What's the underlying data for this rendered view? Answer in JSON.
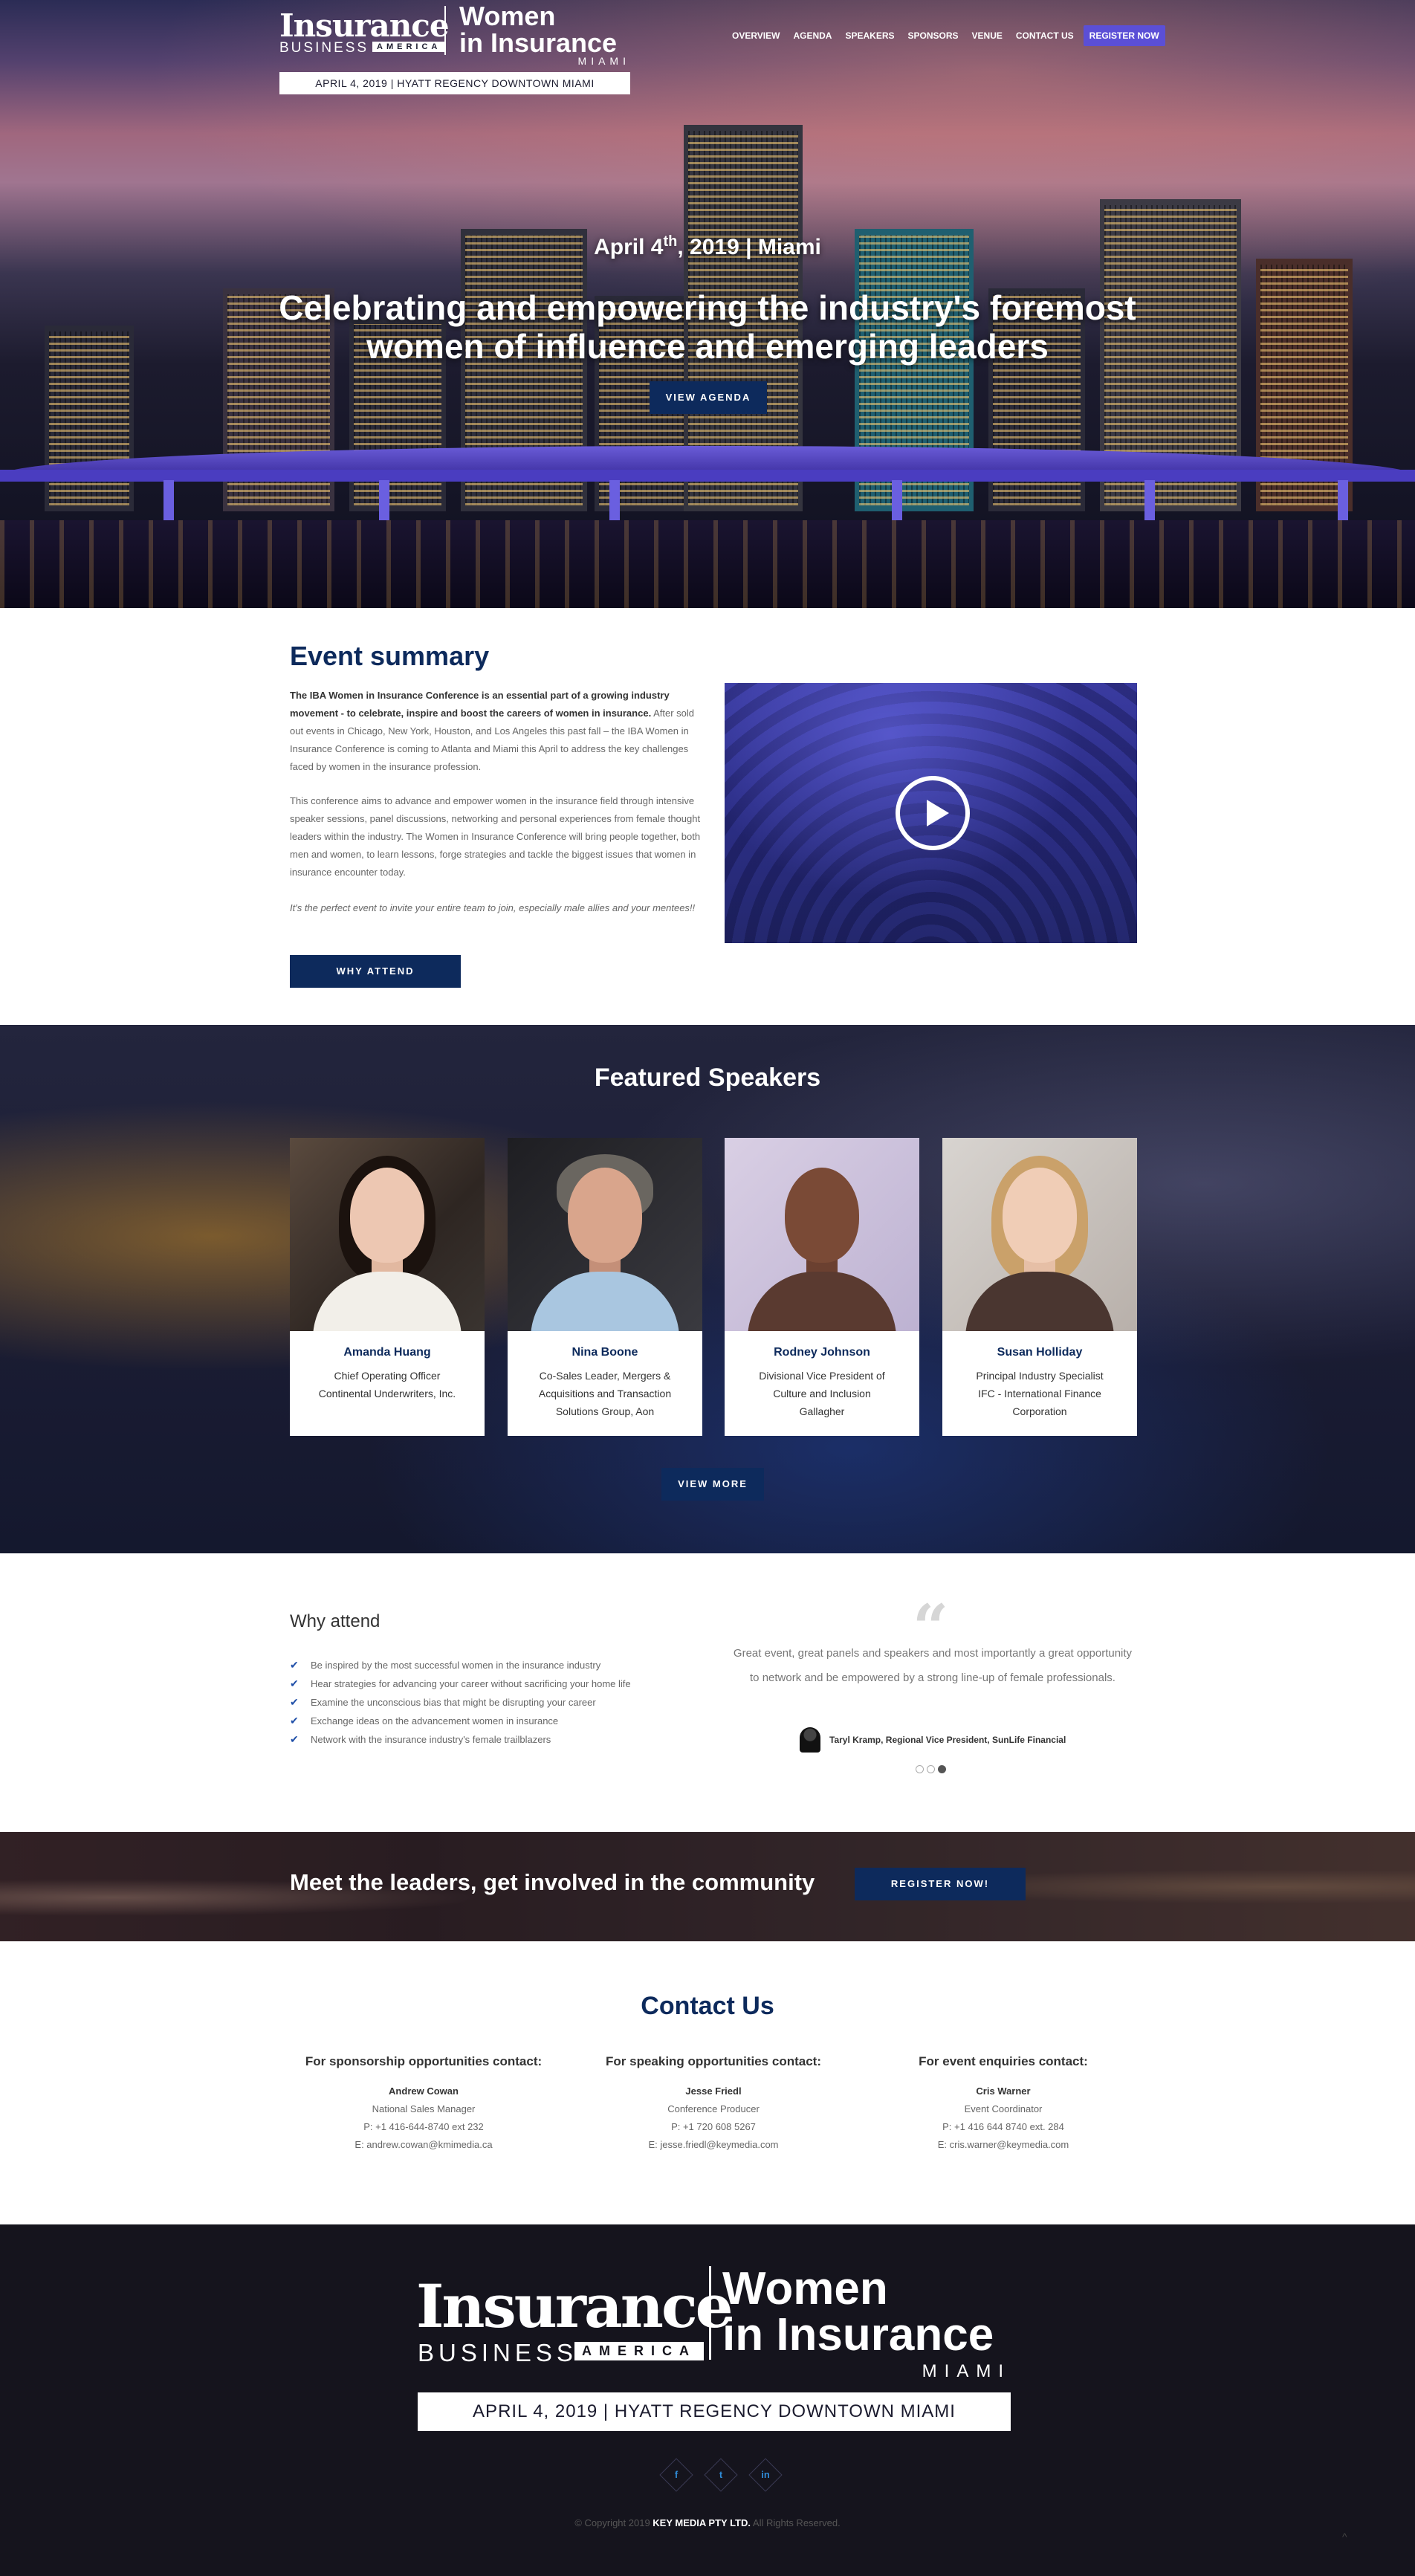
{
  "header": {
    "logo": {
      "insurance": "Insurance",
      "business": "BUSINESS",
      "america": "AMERICA",
      "women": "Women",
      "in_insurance": "in Insurance",
      "city": "MIAMI"
    },
    "date_venue": "APRIL 4, 2019  |  HYATT REGENCY DOWNTOWN MIAMI",
    "nav": [
      "OVERVIEW",
      "AGENDA",
      "SPEAKERS",
      "SPONSORS",
      "VENUE",
      "CONTACT US"
    ],
    "register_label": "REGISTER NOW",
    "register_color": "#5b4fd6"
  },
  "hero": {
    "date_prefix": "April 4",
    "date_sup": "th",
    "date_suffix": ", 2019 | Miami",
    "headline_1": "Celebrating and empowering the industry's foremost",
    "headline_2": "women of influence and emerging leaders",
    "button": "VIEW AGENDA"
  },
  "summary": {
    "title": "Event summary",
    "p1_bold": "The IBA Women in Insurance Conference is an essential part of a growing industry movement - to celebrate, inspire and boost the careers of women in insurance.",
    "p1_rest": " After sold out events in Chicago, New York, Houston, and Los Angeles this past fall – the IBA Women in Insurance Conference is coming to Atlanta and Miami this April to address the key challenges faced by women in the insurance profession.",
    "p2": "This conference aims to advance and empower women in the insurance field through intensive speaker sessions, panel discussions, networking and personal experiences from female thought leaders within the industry. The Women in Insurance Conference will bring people together, both men and women, to learn lessons, forge strategies and tackle the biggest issues that women in insurance encounter today.",
    "p3": "It's the perfect event to invite your entire team to join, especially male allies and your mentees!!",
    "button": "WHY ATTEND",
    "video_icon": "play-icon",
    "brand_color": "#0d2a5c"
  },
  "speakers": {
    "title": "Featured Speakers",
    "items": [
      {
        "name": "Amanda Huang",
        "role_1": "Chief Operating Officer",
        "role_2": "Continental Underwriters, Inc.",
        "role_3": ""
      },
      {
        "name": "Nina Boone",
        "role_1": "Co-Sales Leader, Mergers &",
        "role_2": "Acquisitions and Transaction",
        "role_3": "Solutions Group, Aon"
      },
      {
        "name": "Rodney Johnson",
        "role_1": "Divisional Vice President of",
        "role_2": "Culture and Inclusion",
        "role_3": "Gallagher"
      },
      {
        "name": "Susan Holliday",
        "role_1": "Principal Industry Specialist",
        "role_2": "IFC - International Finance",
        "role_3": "Corporation"
      }
    ],
    "button": "VIEW MORE"
  },
  "why": {
    "title": "Why attend",
    "items": [
      "Be inspired by the most successful women in the insurance industry",
      "Hear strategies for advancing your career without sacrificing your home life",
      "Examine the unconscious bias that might be disrupting your career",
      "Exchange ideas on the advancement women in insurance",
      "Network with the insurance industry's female trailblazers"
    ],
    "quote_mark": "“",
    "quote": "Great event, great panels and speakers and most importantly a great opportunity to network and be empowered by a strong line-up of female professionals.",
    "quote_author": "Taryl Kramp, Regional Vice President, SunLife Financial",
    "slide_active": 3,
    "slide_count": 3
  },
  "cta": {
    "title": "Meet the leaders, get involved in the community",
    "button": "REGISTER NOW!"
  },
  "contact": {
    "title": "Contact Us",
    "columns": [
      {
        "heading": "For sponsorship opportunities contact:",
        "name": "Andrew Cowan",
        "role": "National Sales Manager",
        "phone": "P: +1 416-644-8740 ext 232",
        "email": "E: andrew.cowan@kmimedia.ca"
      },
      {
        "heading": "For speaking opportunities contact:",
        "name": "Jesse Friedl",
        "role": "Conference Producer",
        "phone": "P: +1 720 608 5267",
        "email": "E: jesse.friedl@keymedia.com"
      },
      {
        "heading": "For event enquiries contact:",
        "name": "Cris Warner",
        "role": "Event Coordinator",
        "phone": "P: +1 416 644 8740 ext. 284",
        "email": "E: cris.warner@keymedia.com"
      }
    ]
  },
  "footer": {
    "date_venue": "APRIL 4, 2019  |  HYATT REGENCY DOWNTOWN MIAMI",
    "socials": [
      {
        "icon": "facebook-icon",
        "glyph": "f"
      },
      {
        "icon": "twitter-icon",
        "glyph": "t"
      },
      {
        "icon": "linkedin-icon",
        "glyph": "in"
      }
    ],
    "copyright_prefix": "© Copyright 2019",
    "copyright_company": "KEY MEDIA PTY LTD.",
    "copyright_suffix": "All Rights Reserved.",
    "to_top": "^"
  }
}
